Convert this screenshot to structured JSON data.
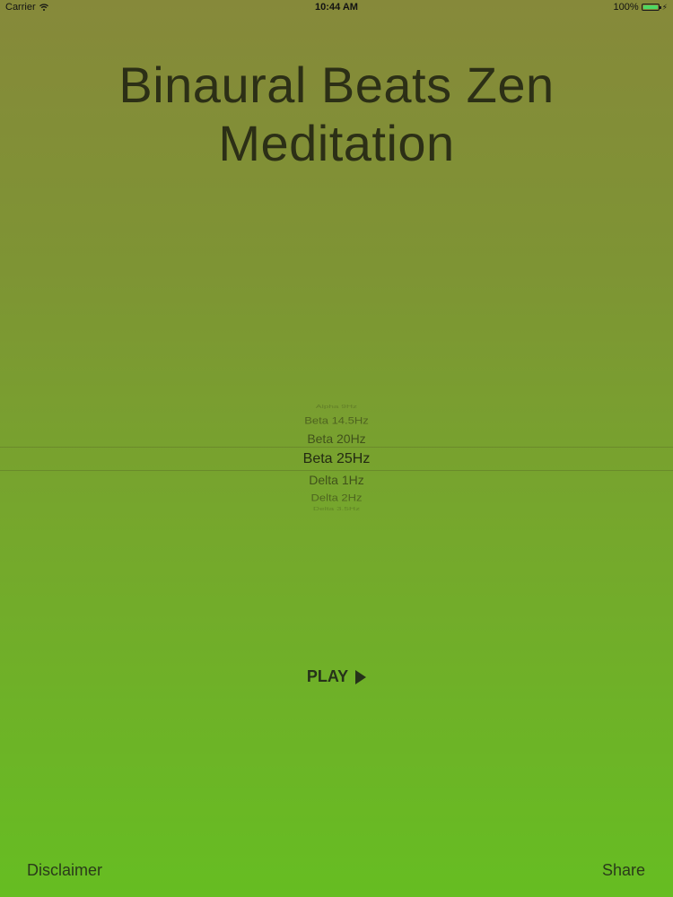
{
  "status_bar": {
    "carrier": "Carrier",
    "time": "10:44 AM",
    "battery": "100%"
  },
  "title": {
    "line1": "Binaural Beats Zen",
    "line2": "Meditation"
  },
  "picker": {
    "items": [
      "Alpha 9Hz",
      "Beta 14.5Hz",
      "Beta 20Hz",
      "Beta 25Hz",
      "Delta 1Hz",
      "Delta 2Hz",
      "Delta 3.5Hz"
    ],
    "selected": "Beta 25Hz"
  },
  "play": {
    "label": "PLAY"
  },
  "footer": {
    "disclaimer": "Disclaimer",
    "share": "Share"
  },
  "colors": {
    "background_top": "#86893a",
    "background_bottom": "#66bd22",
    "text": "#2c2f16",
    "battery": "#4cd964"
  },
  "icons": [
    "wifi-icon",
    "battery-icon",
    "charging-icon",
    "play-icon"
  ]
}
